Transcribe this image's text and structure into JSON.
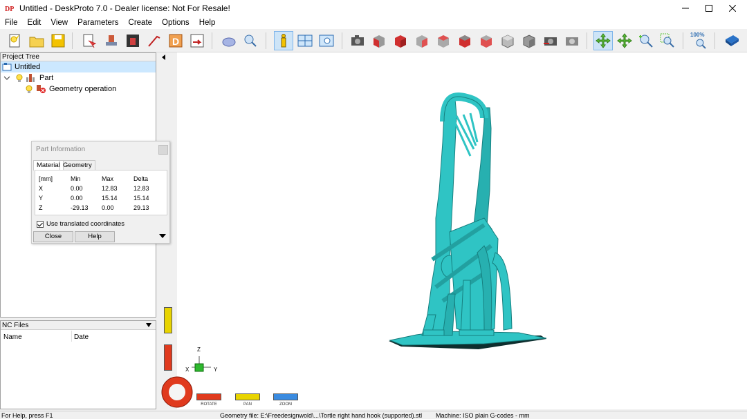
{
  "window": {
    "title": "Untitled - DeskProto 7.0 - Dealer license: Not For Resale!",
    "app_icon": "DP",
    "minimize_icon": "minimize-icon",
    "maximize_icon": "maximize-icon",
    "close_icon": "close-icon"
  },
  "menu": [
    "File",
    "Edit",
    "View",
    "Parameters",
    "Create",
    "Options",
    "Help"
  ],
  "toolbar": {
    "zoom_label": "100%"
  },
  "project_tree": {
    "header": "Project Tree",
    "root": "Untitled",
    "part": "Part",
    "operation": "Geometry operation"
  },
  "nc_files": {
    "header": "NC Files",
    "columns": [
      "Name",
      "Date"
    ]
  },
  "part_info": {
    "title": "Part Information",
    "tabs": [
      "Material",
      "Geometry"
    ],
    "columns": [
      "[mm]",
      "Min",
      "Max",
      "Delta"
    ],
    "rows": [
      [
        "X",
        "0.00",
        "12.83",
        "12.83"
      ],
      [
        "Y",
        "0.00",
        "15.14",
        "15.14"
      ],
      [
        "Z",
        "-29.13",
        "0.00",
        "29.13"
      ]
    ],
    "checkbox_label": "Use translated coordinates",
    "checkbox_checked": true,
    "close_label": "Close",
    "help_label": "Help"
  },
  "viewport": {
    "axes": {
      "z": "Z",
      "x": "X",
      "y": "Y"
    },
    "model_color": "#2fc4c4",
    "controls": [
      "ROTATE",
      "PAN",
      "ZOOM"
    ],
    "control_colors": {
      "rotate": "#e03a1e",
      "pan": "#e8d400",
      "zoom": "#3a8be0"
    }
  },
  "status": {
    "help": "For Help, press F1",
    "geometry": "Geometry file: E:\\Freedesignwold\\...\\Tortle right hand hook (supported).stl",
    "machine": "Machine: ISO plain G-codes - mm"
  }
}
